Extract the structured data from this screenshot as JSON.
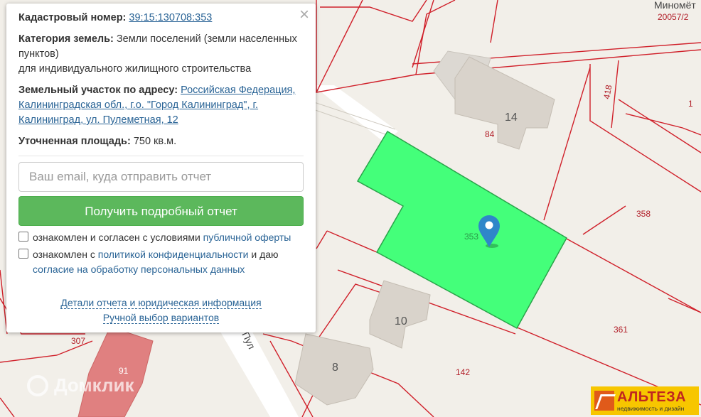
{
  "panel": {
    "close_label": "×",
    "cadastral_label": "Кадастровый номер:",
    "cadastral_value": "39:15:130708:353",
    "category_label": "Категория земель:",
    "category_value": "Земли поселений (земли населенных пунктов)",
    "category_use": "для индивидуального жилищного строительства",
    "address_label": "Земельный участок по адресу:",
    "address_value": "Российская Федерация, Калининградская обл., г.о. \"Город Калининград\", г. Калининград, ул. Пулеметная, 12",
    "area_label": "Уточненная площадь:",
    "area_value": "750 кв.м.",
    "email_placeholder": "Ваш email, куда отправить отчет",
    "email_value": "",
    "submit_label": "Получить подробный отчет",
    "agree_offer_text": "ознакомлен и согласен с условиями",
    "agree_offer_link": "публичной оферты",
    "agree_privacy_text": "ознакомлен с",
    "agree_privacy_link": "политикой конфиденциальности",
    "agree_privacy_and": "и даю",
    "agree_consent_link": "согласие на обработку персональных данных",
    "details_link": "Детали отчета и юридическая информация",
    "manual_link": "Ручной выбор вариантов"
  },
  "map": {
    "plot_labels": {
      "p353": "353",
      "p358": "358",
      "p361": "361",
      "p142": "142",
      "p307": "307",
      "p84": "84",
      "p418": "418",
      "p1": "1",
      "p20057": "20057/2",
      "p91": "91"
    },
    "building_labels": {
      "b14": "14",
      "b10": "10",
      "b8": "8"
    },
    "street_top": "Миномёт",
    "street_side": "Пул",
    "colors": {
      "selected_plot": "#44ff7a",
      "plot_border": "#d0202a",
      "marker": "#2f86c9"
    }
  },
  "watermark": {
    "text": "Домклик",
    "icon": "domclick-icon"
  },
  "logo": {
    "name": "АЛЬТЕЗА",
    "tagline": "недвижимость и дизайн"
  }
}
